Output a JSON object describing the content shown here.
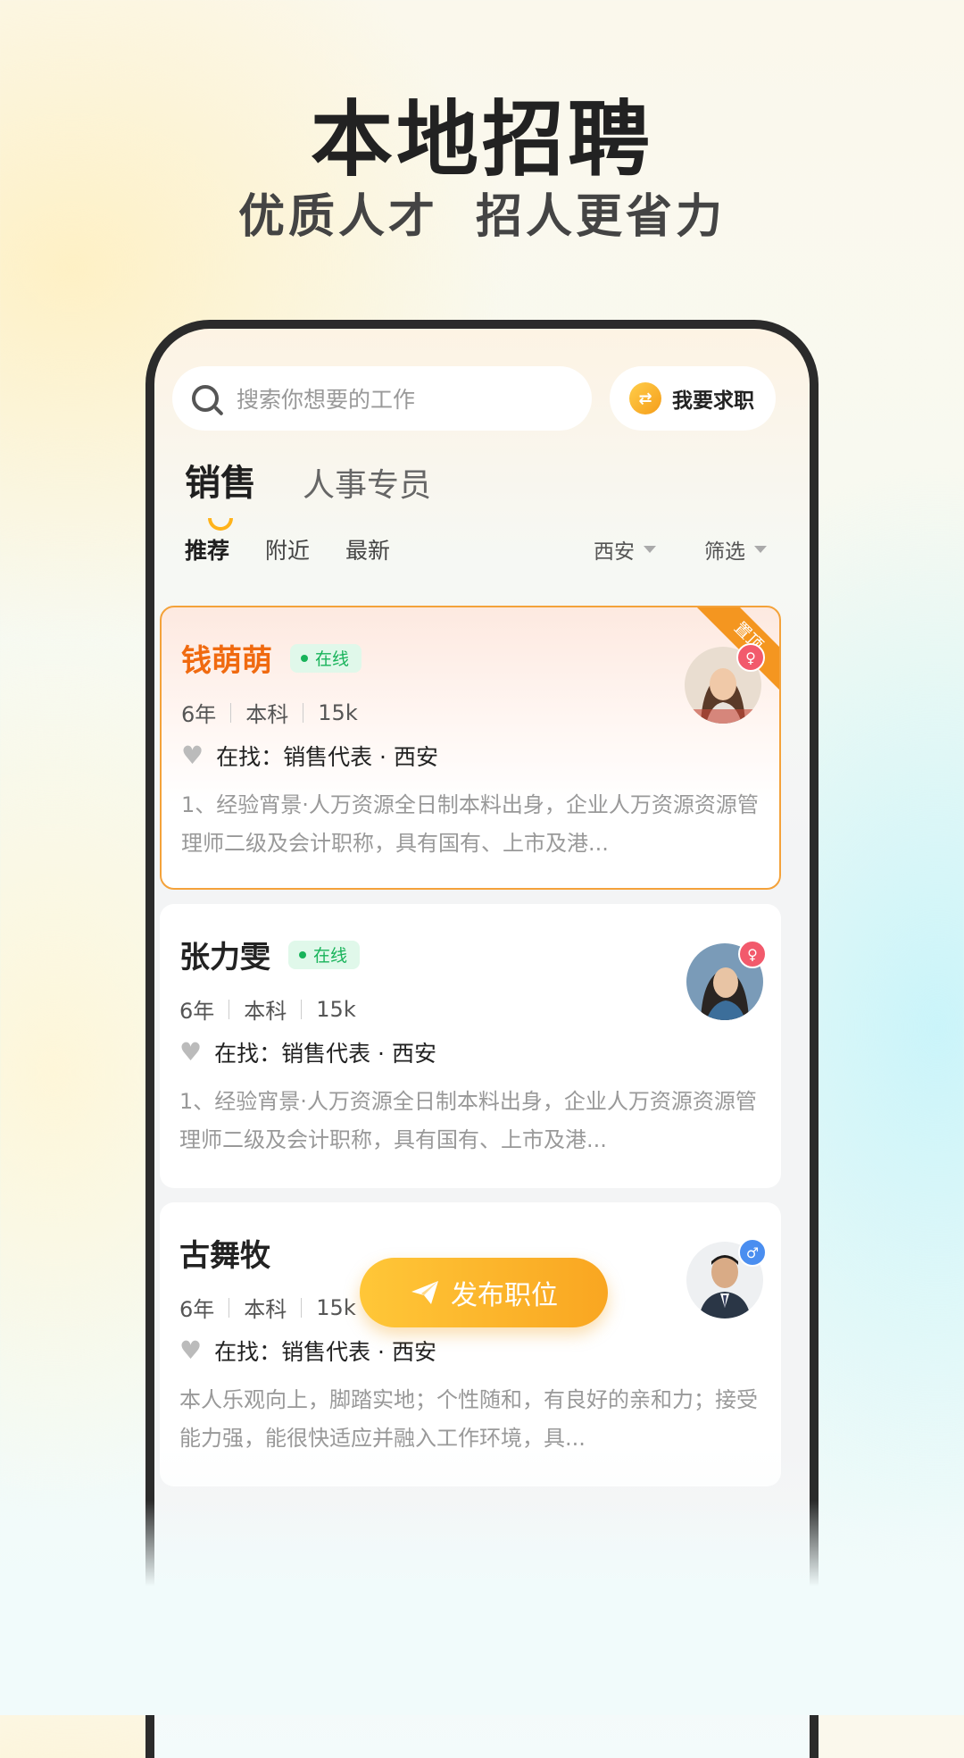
{
  "promo": {
    "headline": "本地招聘",
    "subline": "优质人才  招人更省力"
  },
  "search": {
    "placeholder": "搜索你想要的工作"
  },
  "switch": {
    "label": "我要求职",
    "icon": "swap-icon"
  },
  "tabs": [
    {
      "label": "销售",
      "active": true
    },
    {
      "label": "人事专员",
      "active": false
    }
  ],
  "filters": {
    "sort": [
      "推荐",
      "附近",
      "最新"
    ],
    "city": "西安",
    "screen": "筛选"
  },
  "cards": [
    {
      "name": "钱萌萌",
      "status": "在线",
      "years": "6年",
      "education": "本科",
      "salary": "15k",
      "seeking": "在找：销售代表 · 西安",
      "description": "1、经验宵景·人万资源全日制本料出身，企业人万资源资源管理师二级及会计职称，具有国有、上市及港...",
      "pinned_label": "置顶",
      "gender": "female"
    },
    {
      "name": "张力雯",
      "status": "在线",
      "years": "6年",
      "education": "本科",
      "salary": "15k",
      "seeking": "在找：销售代表 · 西安",
      "description": "1、经验宵景·人万资源全日制本料出身，企业人万资源资源管理师二级及会计职称，具有国有、上市及港...",
      "gender": "female"
    },
    {
      "name": "古舞牧",
      "years": "6年",
      "education": "本科",
      "salary": "15k",
      "seeking": "在找：销售代表 · 西安",
      "description": "本人乐观向上，脚踏实地；个性随和，有良好的亲和力；接受能力强，能很快适应并融入工作环境，具...",
      "gender": "male"
    }
  ],
  "post_button": {
    "label": "发布职位",
    "icon": "paper-plane-icon"
  },
  "colors": {
    "accent": "#f9a621",
    "highlight_name": "#f06a10",
    "online": "#18b35a"
  }
}
